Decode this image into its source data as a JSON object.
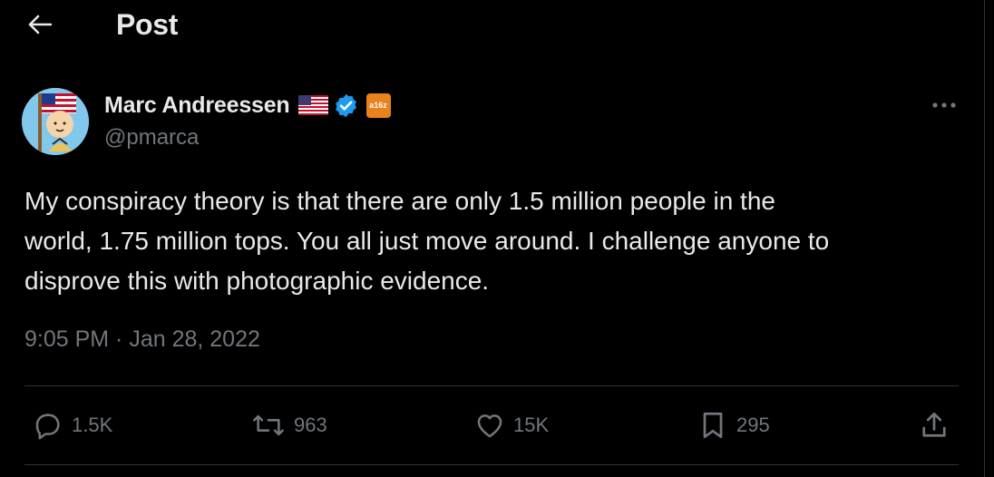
{
  "header": {
    "title": "Post",
    "back_icon": "arrow-left-icon"
  },
  "author": {
    "display_name": "Marc Andreessen",
    "handle": "@pmarca",
    "flag_icon": "us-flag-icon",
    "verified_icon": "verified-badge-icon",
    "affiliation_label": "a16z",
    "verified_color": "#1d9bf0",
    "affiliation_color": "#e8821c"
  },
  "post": {
    "text": "My conspiracy theory is that there are only 1.5 million people in the\nworld, 1.75 million tops. You all just move around. I challenge anyone to\ndisprove this with photographic evidence.",
    "timestamp": "9:05 PM · Jan 28, 2022"
  },
  "actions": {
    "replies": "1.5K",
    "reposts": "963",
    "likes": "15K",
    "bookmarks": "295"
  },
  "colors": {
    "background": "#000000",
    "text": "#e7e9ea",
    "muted": "#71767b",
    "divider": "#2f3336"
  }
}
